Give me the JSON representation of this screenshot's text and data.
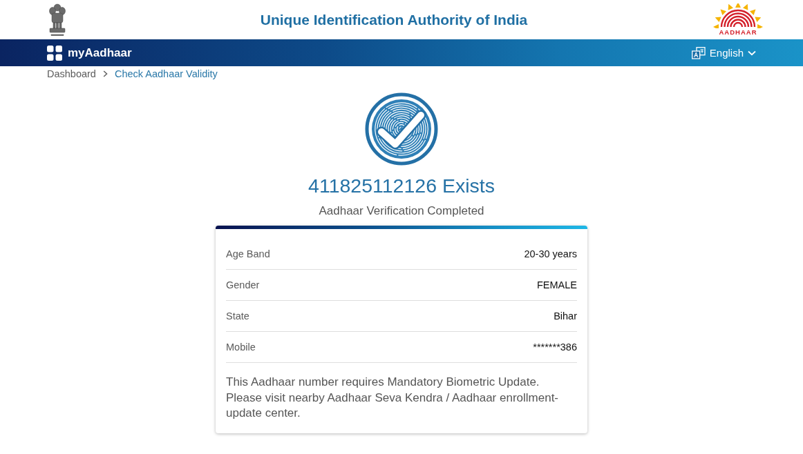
{
  "header": {
    "title": "Unique Identification Authority of India",
    "logo_text": "AADHAAR"
  },
  "navbar": {
    "brand": "myAadhaar",
    "language": "English"
  },
  "breadcrumb": [
    {
      "label": "Dashboard",
      "current": false
    },
    {
      "label": "Check Aadhaar Validity",
      "current": true
    }
  ],
  "result": {
    "heading": "411825112126 Exists",
    "subheading": "Aadhaar Verification Completed"
  },
  "details": [
    {
      "label": "Age Band",
      "value": "20-30 years"
    },
    {
      "label": "Gender",
      "value": "FEMALE"
    },
    {
      "label": "State",
      "value": "Bihar"
    },
    {
      "label": "Mobile",
      "value": "*******386"
    }
  ],
  "notice": "This Aadhaar number requires Mandatory Biometric Update. Please visit nearby Aadhaar Seva Kendra / Aadhaar enrollment-update center."
}
